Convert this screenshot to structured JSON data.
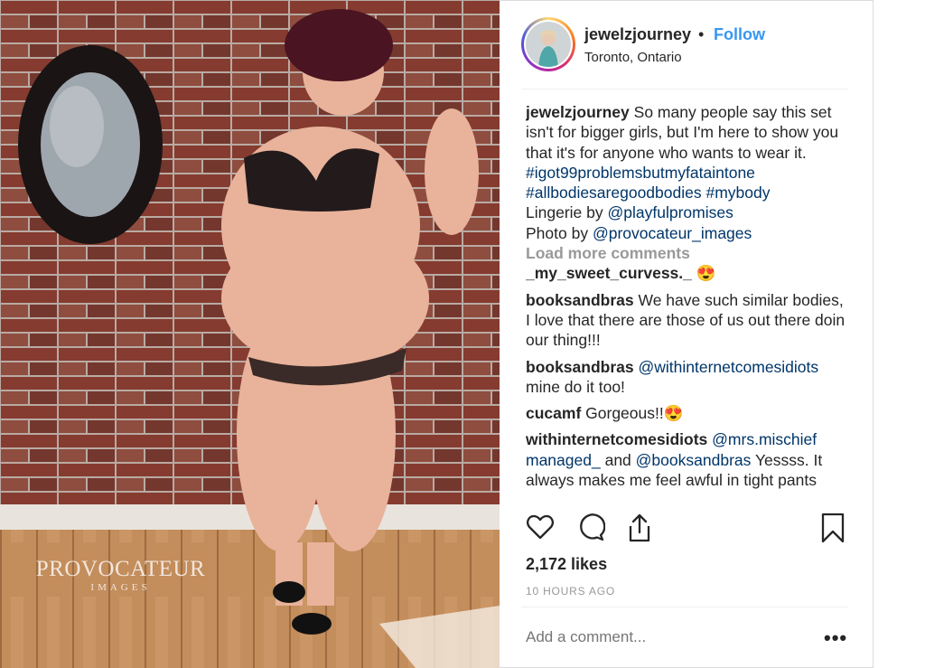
{
  "post": {
    "username": "jewelzjourney",
    "follow_label": "Follow",
    "location": "Toronto, Ontario",
    "watermark": {
      "line1": "PROVOCATEUR",
      "line2": "IMAGES"
    }
  },
  "caption": {
    "username": "jewelzjourney",
    "text": "So many people say this set isn't for bigger girls, but I'm here to show you that it's for anyone who wants to wear it.",
    "hashtags": [
      "#igot99problemsbutmyfataintone",
      "#allbodiesaregoodbodies",
      "#mybody"
    ],
    "lingerie_prefix": "Lingerie by",
    "lingerie_handle": "@playfulpromises",
    "photo_prefix": "Photo by",
    "photo_handle": "@provocateur_images"
  },
  "load_more": "Load more comments",
  "comments": [
    {
      "user": "_my_sweet_curvess._",
      "emoji": "😍"
    },
    {
      "user": "booksandbras",
      "text": "We have such similar bodies, I love that there are those of us out there doin our thing!!!"
    },
    {
      "user": "booksandbras",
      "mention": "@withinternetcomesidiots",
      "text": "mine do it too!"
    },
    {
      "user": "cucamf",
      "text": "Gorgeous!!😍"
    },
    {
      "user": "withinternetcomesidiots",
      "mention1": "@mrs.mischief managed_",
      "mid": "and",
      "mention2": "@booksandbras",
      "text": "Yessss. It always makes me feel awful in tight pants"
    }
  ],
  "likes": "2,172 likes",
  "time": "10 HOURS AGO",
  "add_comment_placeholder": "Add a comment...",
  "more_label": "•••",
  "colors": {
    "link": "#003569",
    "follow": "#3897f0",
    "muted": "#999999",
    "text": "#262626"
  },
  "icons": [
    "heart-icon",
    "comment-icon",
    "share-icon",
    "bookmark-icon"
  ]
}
